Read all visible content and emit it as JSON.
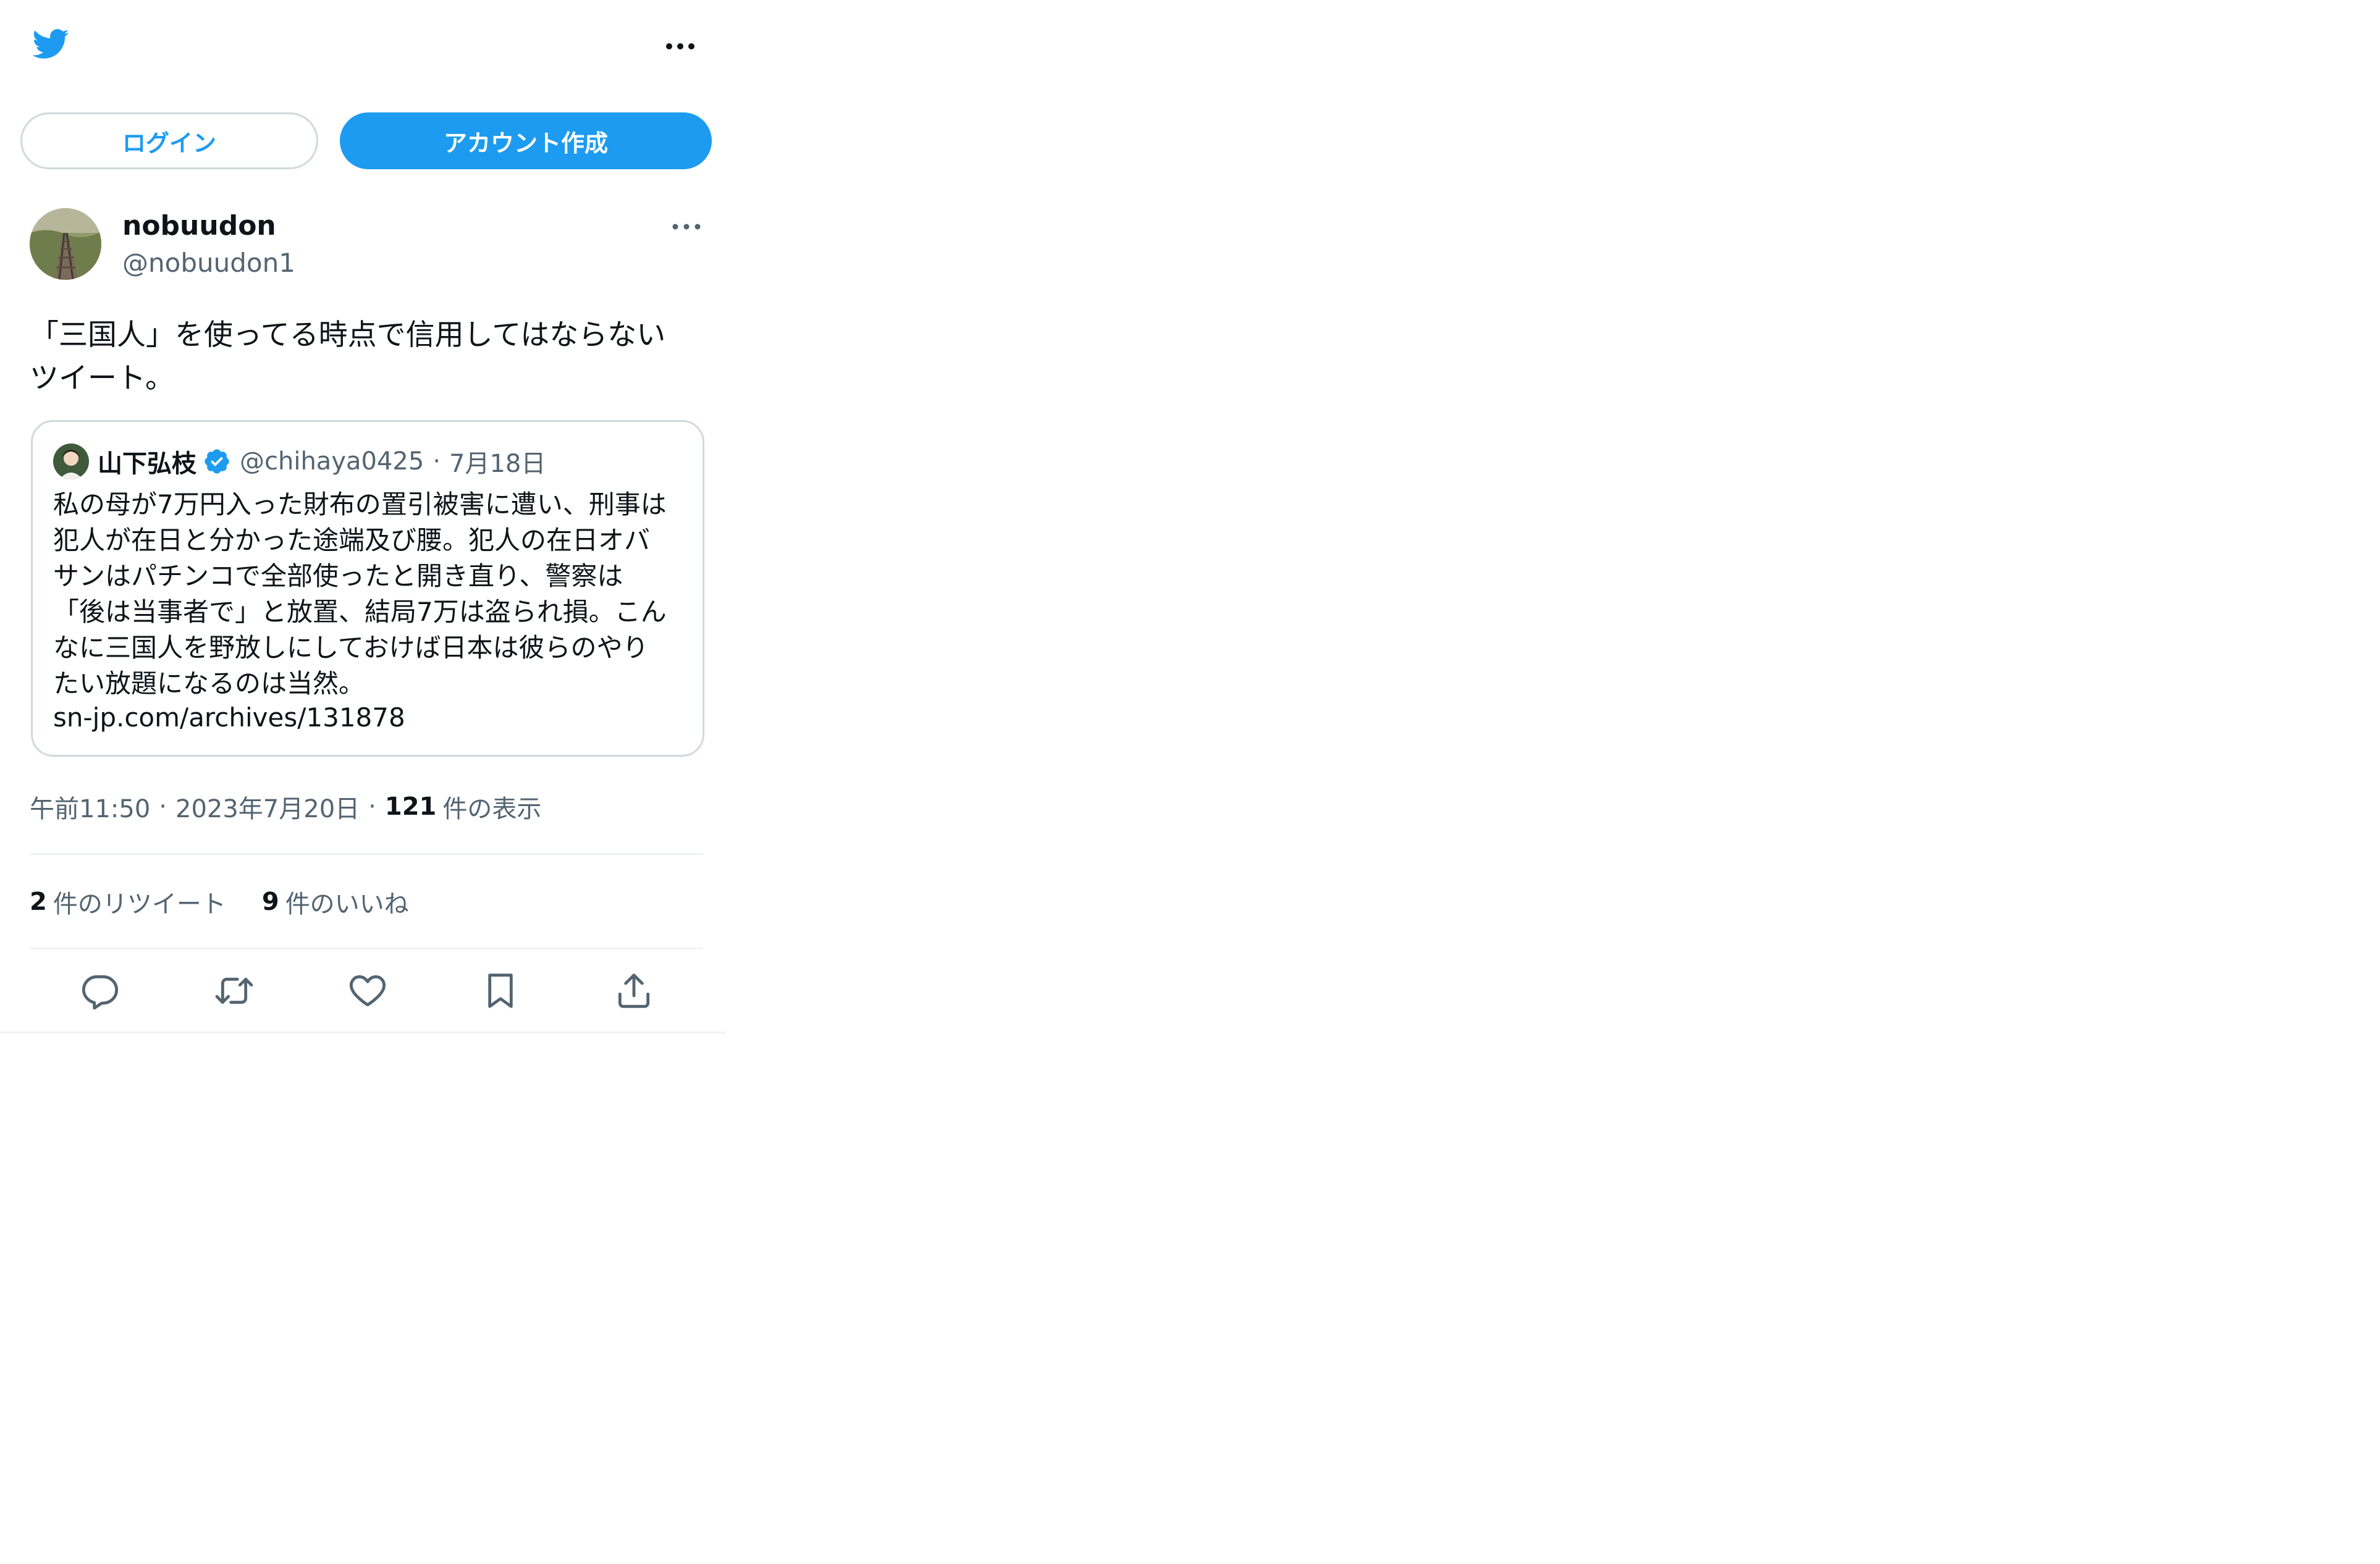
{
  "header": {
    "logo_icon": "twitter-bird-icon",
    "more_icon": "more-horizontal-icon"
  },
  "auth": {
    "login_label": "ログイン",
    "signup_label": "アカウント作成"
  },
  "tweet": {
    "author": {
      "name": "nobuudon",
      "handle": "@nobuudon1",
      "avatar_icon": "avatar-image"
    },
    "text": "「三国人」を使ってる時点で信用してはならない\nツイート。",
    "quote": {
      "author_name": "山下弘枝",
      "verified_icon": "verified-badge-icon",
      "handle": "@chihaya0425",
      "separator": "·",
      "date": "7月18日",
      "text": "私の母が7万円入った財布の置引被害に遭い、刑事は\n犯人が在日と分かった途端及び腰。犯人の在日オバ\nサンはパチンコで全部使ったと開き直り、警察は\n「後は当事者で」と放置、結局7万は盗られ損。こん\nなに三国人を野放しにしておけば日本は彼らのやり\nたい放題になるのは当然。",
      "link": "sn-jp.com/archives/131878"
    },
    "meta": {
      "time": "午前11:50",
      "date": "2023年7月20日",
      "separator": "·",
      "views_count": "121",
      "views_label": "件の表示"
    },
    "stats": {
      "retweets_count": "2",
      "retweets_label": "件のリツイート",
      "likes_count": "9",
      "likes_label": "件のいいね"
    },
    "actions": [
      "reply-icon",
      "retweet-icon",
      "like-icon",
      "bookmark-icon",
      "share-icon"
    ]
  },
  "colors": {
    "brand": "#1d9bf0",
    "text_primary": "#0f1419",
    "text_secondary": "#536471",
    "border": "#cfd9de",
    "divider": "#eff3f4"
  }
}
